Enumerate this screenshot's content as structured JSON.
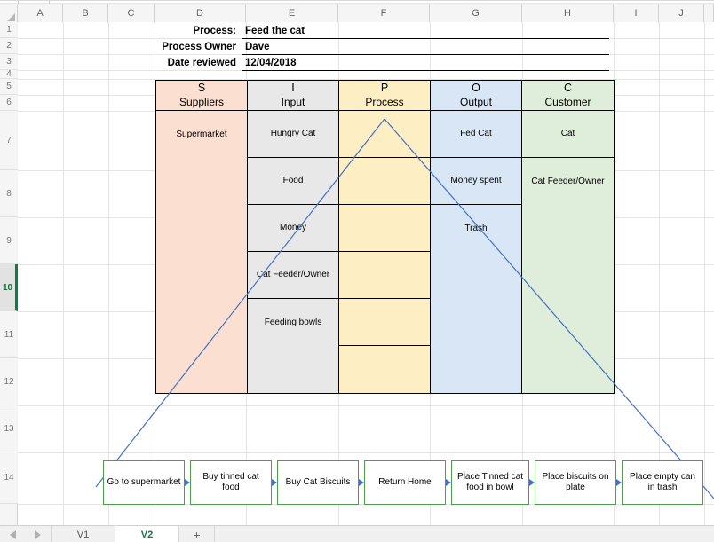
{
  "app": {
    "type": "spreadsheet",
    "columns": [
      "A",
      "B",
      "C",
      "D",
      "E",
      "F",
      "G",
      "H",
      "I",
      "J"
    ],
    "rows": [
      "1",
      "2",
      "3",
      "4",
      "5",
      "6",
      "7",
      "8",
      "9",
      "10",
      "11",
      "12",
      "13",
      "14"
    ],
    "selected_row": "10",
    "accent_color": "#107c41"
  },
  "form": {
    "fields": [
      {
        "label": "Process:",
        "value": "Feed the cat"
      },
      {
        "label": "Process Owner",
        "value": "Dave"
      },
      {
        "label": "Date reviewed",
        "value": "12/04/2018"
      }
    ]
  },
  "sipoc": {
    "columns": [
      {
        "letter": "S",
        "title": "Suppliers",
        "color": "#fbdfd0",
        "cells": [
          "Supermarket",
          "",
          "",
          "",
          "",
          ""
        ]
      },
      {
        "letter": "I",
        "title": "Input",
        "color": "#e8e8e8",
        "cells": [
          "Hungry Cat",
          "Food",
          "Money",
          "Cat Feeder/Owner",
          "Feeding bowls",
          ""
        ]
      },
      {
        "letter": "P",
        "title": "Process",
        "color": "#fdeec3",
        "cells": [
          "",
          "",
          "",
          "",
          "",
          ""
        ]
      },
      {
        "letter": "O",
        "title": "Output",
        "color": "#d9e6f5",
        "cells": [
          "Fed Cat",
          "Money spent",
          "Trash",
          "",
          "",
          ""
        ]
      },
      {
        "letter": "C",
        "title": "Customer",
        "color": "#dfeeda",
        "cells": [
          "Cat",
          "Cat Feeder/Owner",
          "",
          "",
          "",
          ""
        ]
      }
    ]
  },
  "process_flow": {
    "box_border_color": "#4d9e4d",
    "arrow_color": "#4472c4",
    "steps": [
      "Go to supermarket",
      "Buy tinned cat food",
      "Buy Cat Biscuits",
      "Return Home",
      "Place Tinned cat food in bowl",
      "Place biscuits on plate",
      "Place empty can in trash"
    ]
  },
  "connectors": {
    "color": "#4472c4",
    "description": "Two diagonal lines from the Process column apex fanning out to the process-flow row"
  },
  "tabbar": {
    "nav_prev": "prev-sheet",
    "nav_next": "next-sheet",
    "sheets": [
      {
        "name": "V1",
        "active": false
      },
      {
        "name": "V2",
        "active": true
      }
    ],
    "add_label": "+"
  }
}
